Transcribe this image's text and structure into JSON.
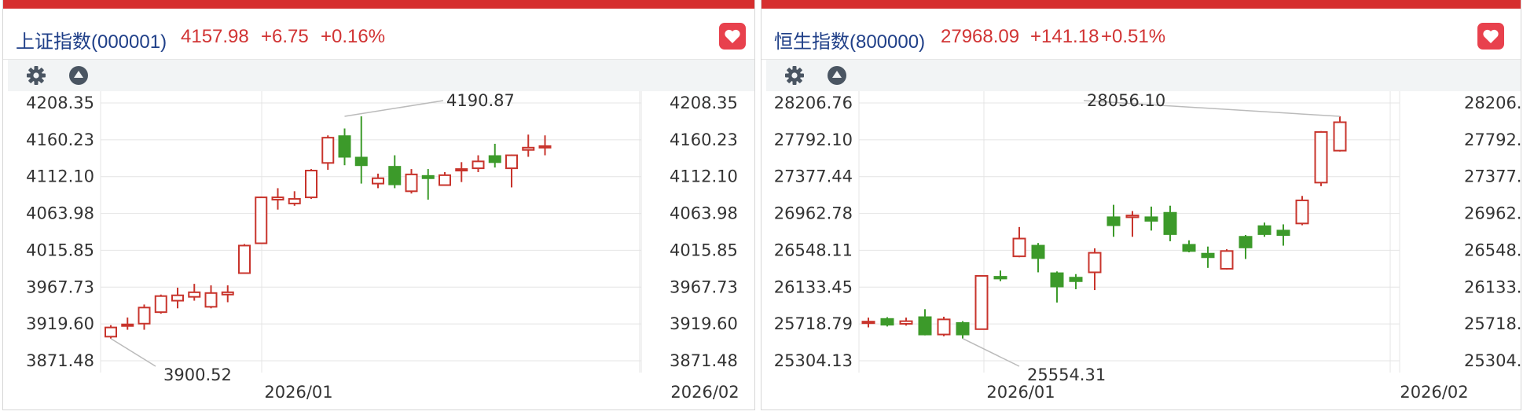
{
  "colors": {
    "up": "#c8342c",
    "down": "#3c9a2a",
    "grid": "#e4e4e4",
    "axis_text": "#333333",
    "name": "#1f3f88",
    "quote": "#d13434"
  },
  "icons": {
    "settings": "gear-icon",
    "collapse": "triangle-up-icon",
    "favorite": "heart-icon"
  },
  "panels": [
    {
      "name": "上证指数(000001)",
      "price": "4157.98",
      "change": "+6.75",
      "change_pct": "+0.16%",
      "chart_data": {
        "type": "candlestick",
        "ylim": [
          3871.48,
          4208.35
        ],
        "y_ticks": [
          "4208.35",
          "4160.23",
          "4112.10",
          "4063.98",
          "4015.85",
          "3967.73",
          "3919.60",
          "3871.48"
        ],
        "x_ticks": [
          {
            "label": "2026/01",
            "index": 8
          },
          {
            "label": "2026/02",
            "index": 28
          }
        ],
        "annotations": [
          {
            "label": "4190.87",
            "index": 14,
            "value": 4190.87,
            "type": "high"
          },
          {
            "label": "3900.52",
            "index": 0,
            "value": 3900.52,
            "type": "low"
          }
        ],
        "grid": true,
        "candles": [
          {
            "o": 3903,
            "c": 3915,
            "h": 3918,
            "l": 3900.52
          },
          {
            "o": 3917,
            "c": 3919,
            "h": 3928,
            "l": 3912
          },
          {
            "o": 3920,
            "c": 3941,
            "h": 3945,
            "l": 3912
          },
          {
            "o": 3935,
            "c": 3956,
            "h": 3958,
            "l": 3933
          },
          {
            "o": 3950,
            "c": 3957,
            "h": 3967,
            "l": 3940
          },
          {
            "o": 3955,
            "c": 3961,
            "h": 3972,
            "l": 3950
          },
          {
            "o": 3942,
            "c": 3960,
            "h": 3970,
            "l": 3940
          },
          {
            "o": 3958,
            "c": 3961,
            "h": 3970,
            "l": 3948
          },
          {
            "o": 3986,
            "c": 4022,
            "h": 4024,
            "l": 3985
          },
          {
            "o": 4025,
            "c": 4085,
            "h": 4086,
            "l": 4024
          },
          {
            "o": 4082,
            "c": 4085,
            "h": 4097,
            "l": 4069
          },
          {
            "o": 4077,
            "c": 4083,
            "h": 4093,
            "l": 4074
          },
          {
            "o": 4085,
            "c": 4120,
            "h": 4122,
            "l": 4083
          },
          {
            "o": 4130,
            "c": 4163,
            "h": 4166,
            "l": 4121
          },
          {
            "o": 4165,
            "c": 4138,
            "h": 4175,
            "l": 4127
          },
          {
            "o": 4137,
            "c": 4127,
            "h": 4190.87,
            "l": 4103
          },
          {
            "o": 4103,
            "c": 4110,
            "h": 4116,
            "l": 4097
          },
          {
            "o": 4125,
            "c": 4102,
            "h": 4140,
            "l": 4097
          },
          {
            "o": 4093,
            "c": 4115,
            "h": 4122,
            "l": 4090
          },
          {
            "o": 4113,
            "c": 4110,
            "h": 4122,
            "l": 4082
          },
          {
            "o": 4101,
            "c": 4114,
            "h": 4118,
            "l": 4100
          },
          {
            "o": 4120,
            "c": 4122,
            "h": 4131,
            "l": 4105
          },
          {
            "o": 4123,
            "c": 4132,
            "h": 4140,
            "l": 4118
          },
          {
            "o": 4139,
            "c": 4131,
            "h": 4155,
            "l": 4124
          },
          {
            "o": 4123,
            "c": 4140,
            "h": 4141,
            "l": 4098
          },
          {
            "o": 4147,
            "c": 4150,
            "h": 4167,
            "l": 4138
          },
          {
            "o": 4150,
            "c": 4152,
            "h": 4166,
            "l": 4140
          }
        ]
      }
    },
    {
      "name": "恒生指数(800000)",
      "price": "27968.09",
      "change": "+141.18",
      "change_pct": "+0.51%",
      "chart_data": {
        "type": "candlestick",
        "ylim": [
          25304.13,
          28206.76
        ],
        "y_ticks": [
          "28206.76",
          "27792.10",
          "27377.44",
          "26962.78",
          "26548.11",
          "26133.45",
          "25718.79",
          "25304.13"
        ],
        "x_ticks": [
          {
            "label": "2026/01",
            "index": 6.5
          },
          {
            "label": "2026/02",
            "index": 29
          }
        ],
        "annotations": [
          {
            "label": "28056.10",
            "index": 25,
            "value": 28056.1,
            "type": "high"
          },
          {
            "label": "25554.31",
            "index": 5,
            "value": 25554.31,
            "type": "low"
          }
        ],
        "grid": true,
        "candles": [
          {
            "o": 25735,
            "c": 25745,
            "h": 25790,
            "l": 25680
          },
          {
            "o": 25775,
            "c": 25710,
            "h": 25795,
            "l": 25690
          },
          {
            "o": 25720,
            "c": 25750,
            "h": 25790,
            "l": 25700
          },
          {
            "o": 25795,
            "c": 25600,
            "h": 25885,
            "l": 25590
          },
          {
            "o": 25600,
            "c": 25770,
            "h": 25800,
            "l": 25580
          },
          {
            "o": 25730,
            "c": 25600,
            "h": 25750,
            "l": 25554.31
          },
          {
            "o": 25660,
            "c": 26260,
            "h": 26265,
            "l": 25655
          },
          {
            "o": 26250,
            "c": 26230,
            "h": 26320,
            "l": 26200
          },
          {
            "o": 26480,
            "c": 26680,
            "h": 26810,
            "l": 26470
          },
          {
            "o": 26600,
            "c": 26460,
            "h": 26630,
            "l": 26300
          },
          {
            "o": 26290,
            "c": 26140,
            "h": 26310,
            "l": 25960
          },
          {
            "o": 26240,
            "c": 26200,
            "h": 26280,
            "l": 26110
          },
          {
            "o": 26300,
            "c": 26520,
            "h": 26570,
            "l": 26100
          },
          {
            "o": 26920,
            "c": 26830,
            "h": 27060,
            "l": 26700
          },
          {
            "o": 26920,
            "c": 26940,
            "h": 26990,
            "l": 26700
          },
          {
            "o": 26920,
            "c": 26880,
            "h": 27040,
            "l": 26770
          },
          {
            "o": 26970,
            "c": 26730,
            "h": 27050,
            "l": 26650
          },
          {
            "o": 26610,
            "c": 26540,
            "h": 26660,
            "l": 26525
          },
          {
            "o": 26510,
            "c": 26470,
            "h": 26590,
            "l": 26350
          },
          {
            "o": 26340,
            "c": 26540,
            "h": 26560,
            "l": 26330
          },
          {
            "o": 26700,
            "c": 26580,
            "h": 26720,
            "l": 26450
          },
          {
            "o": 26820,
            "c": 26730,
            "h": 26860,
            "l": 26700
          },
          {
            "o": 26770,
            "c": 26720,
            "h": 26840,
            "l": 26600
          },
          {
            "o": 26850,
            "c": 27110,
            "h": 27160,
            "l": 26830
          },
          {
            "o": 27310,
            "c": 27880,
            "h": 27890,
            "l": 27270
          },
          {
            "o": 27670,
            "c": 27990,
            "h": 28056.1,
            "l": 27660
          }
        ]
      }
    }
  ]
}
